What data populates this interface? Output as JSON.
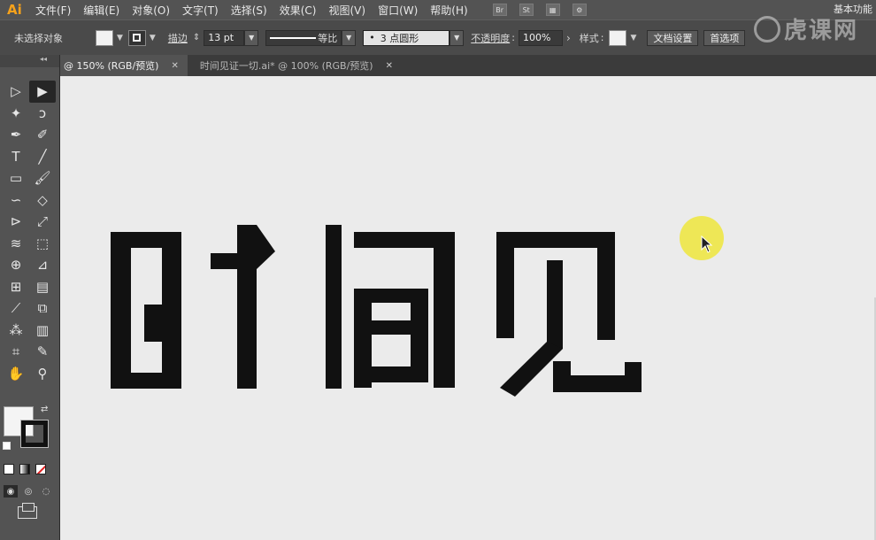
{
  "app": {
    "logo": "Ai",
    "workspace": "基本功能"
  },
  "menu": [
    "文件(F)",
    "编辑(E)",
    "对象(O)",
    "文字(T)",
    "选择(S)",
    "效果(C)",
    "视图(V)",
    "窗口(W)",
    "帮助(H)"
  ],
  "menu_icons": {
    "bridge": "Br",
    "stock": "St"
  },
  "control": {
    "selection": "未选择对象",
    "stroke_label": "描边",
    "stroke_weight": "13 pt",
    "stroke_profile": "等比",
    "brush": "3 点圆形",
    "opacity_label": "不透明度",
    "opacity": "100%",
    "style_label": "样式",
    "doc_setup": "文档设置",
    "preferences": "首选项"
  },
  "tabs": [
    {
      "label": "@ 150% (RGB/预览)",
      "close": "✕"
    },
    {
      "label": "时间见证一切.ai* @ 100% (RGB/预览)",
      "close": "✕"
    }
  ],
  "toolbar_header": "◂◂",
  "tools": [
    {
      "name": "selection-tool",
      "glyph": "▷"
    },
    {
      "name": "direct-selection-tool",
      "glyph": "▶"
    },
    {
      "name": "magic-wand-tool",
      "glyph": "✦"
    },
    {
      "name": "lasso-tool",
      "glyph": "ↄ"
    },
    {
      "name": "pen-tool",
      "glyph": "✒"
    },
    {
      "name": "curvature-tool",
      "glyph": "✐"
    },
    {
      "name": "type-tool",
      "glyph": "T"
    },
    {
      "name": "line-tool",
      "glyph": "╱"
    },
    {
      "name": "rectangle-tool",
      "glyph": "▭"
    },
    {
      "name": "paintbrush-tool",
      "glyph": "🖌"
    },
    {
      "name": "shaper-tool",
      "glyph": "∽"
    },
    {
      "name": "eraser-tool",
      "glyph": "◇"
    },
    {
      "name": "reflect-tool",
      "glyph": "⊳"
    },
    {
      "name": "scale-tool",
      "glyph": "⤢"
    },
    {
      "name": "warp-tool",
      "glyph": "≋"
    },
    {
      "name": "free-transform-tool",
      "glyph": "⬚"
    },
    {
      "name": "shape-builder-tool",
      "glyph": "⊕"
    },
    {
      "name": "perspective-grid-tool",
      "glyph": "⊿"
    },
    {
      "name": "mesh-tool",
      "glyph": "⊞"
    },
    {
      "name": "gradient-tool",
      "glyph": "▤"
    },
    {
      "name": "eyedropper-tool",
      "glyph": "⟋"
    },
    {
      "name": "blend-tool",
      "glyph": "⧉"
    },
    {
      "name": "symbol-sprayer-tool",
      "glyph": "⁂"
    },
    {
      "name": "column-graph-tool",
      "glyph": "▥"
    },
    {
      "name": "artboard-tool",
      "glyph": "⌗"
    },
    {
      "name": "slice-tool",
      "glyph": "✎"
    },
    {
      "name": "hand-tool",
      "glyph": "✋"
    },
    {
      "name": "zoom-tool",
      "glyph": "⚲"
    }
  ],
  "canvas_text": "时间见",
  "watermark": "虎课网",
  "colors": {
    "artwork": "#111111",
    "canvas": "#ebebeb",
    "cursor_highlight": "#eee63c",
    "logo": "#f7a21b"
  }
}
